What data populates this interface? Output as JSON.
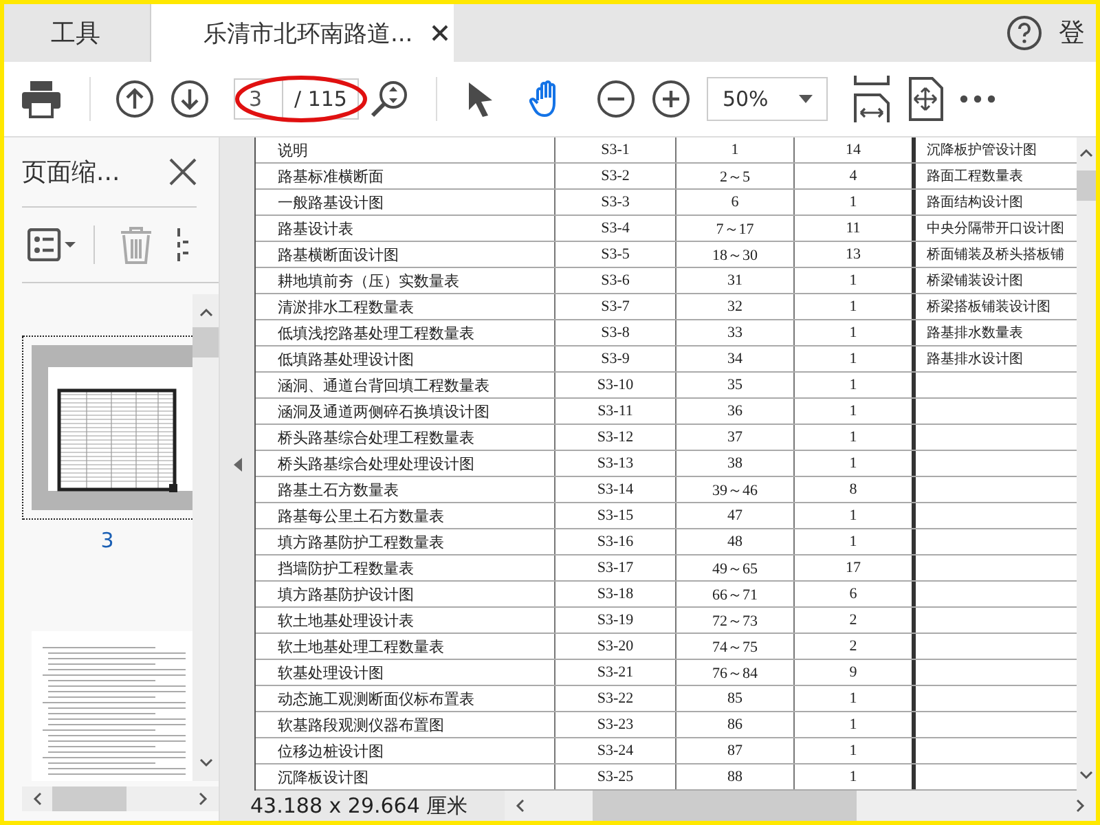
{
  "tabs": [
    {
      "label": "工具",
      "selected": false
    },
    {
      "label": "乐清市北环南路道...",
      "selected": true
    }
  ],
  "header": {
    "account_link": "登"
  },
  "toolbar": {
    "page_field": {
      "value": "3"
    },
    "page_total": "/ 115",
    "zoom": {
      "value": "50%"
    },
    "tools": [
      {
        "kind": "select",
        "selected": false
      },
      {
        "kind": "hand",
        "selected": true
      }
    ]
  },
  "side_panel": {
    "title": "页面缩...",
    "thumbnails": [
      {
        "kind": "table",
        "label": "3",
        "selected": true
      },
      {
        "kind": "text",
        "selected": false
      }
    ]
  },
  "document": {
    "rows": [
      {
        "name": "说明",
        "code": "S3-1",
        "pages": "1",
        "count": "14"
      },
      {
        "name": "路基标准横断面",
        "code": "S3-2",
        "pages": "2～5",
        "count": "4"
      },
      {
        "name": "一般路基设计图",
        "code": "S3-3",
        "pages": "6",
        "count": "1"
      },
      {
        "name": "路基设计表",
        "code": "S3-4",
        "pages": "7～17",
        "count": "11"
      },
      {
        "name": "路基横断面设计图",
        "code": "S3-5",
        "pages": "18～30",
        "count": "13"
      },
      {
        "name": "耕地填前夯（压）实数量表",
        "code": "S3-6",
        "pages": "31",
        "count": "1"
      },
      {
        "name": "清淤排水工程数量表",
        "code": "S3-7",
        "pages": "32",
        "count": "1"
      },
      {
        "name": "低填浅挖路基处理工程数量表",
        "code": "S3-8",
        "pages": "33",
        "count": "1"
      },
      {
        "name": "低填路基处理设计图",
        "code": "S3-9",
        "pages": "34",
        "count": "1"
      },
      {
        "name": "涵洞、通道台背回填工程数量表",
        "code": "S3-10",
        "pages": "35",
        "count": "1"
      },
      {
        "name": "涵洞及通道两侧碎石换填设计图",
        "code": "S3-11",
        "pages": "36",
        "count": "1"
      },
      {
        "name": "桥头路基综合处理工程数量表",
        "code": "S3-12",
        "pages": "37",
        "count": "1"
      },
      {
        "name": "桥头路基综合处理处理设计图",
        "code": "S3-13",
        "pages": "38",
        "count": "1"
      },
      {
        "name": "路基土石方数量表",
        "code": "S3-14",
        "pages": "39～46",
        "count": "8"
      },
      {
        "name": "路基每公里土石方数量表",
        "code": "S3-15",
        "pages": "47",
        "count": "1"
      },
      {
        "name": "填方路基防护工程数量表",
        "code": "S3-16",
        "pages": "48",
        "count": "1"
      },
      {
        "name": "挡墙防护工程数量表",
        "code": "S3-17",
        "pages": "49～65",
        "count": "17"
      },
      {
        "name": "填方路基防护设计图",
        "code": "S3-18",
        "pages": "66～71",
        "count": "6"
      },
      {
        "name": "软土地基处理设计表",
        "code": "S3-19",
        "pages": "72～73",
        "count": "2"
      },
      {
        "name": "软土地基处理工程数量表",
        "code": "S3-20",
        "pages": "74～75",
        "count": "2"
      },
      {
        "name": "软基处理设计图",
        "code": "S3-21",
        "pages": "76～84",
        "count": "9"
      },
      {
        "name": "动态施工观测断面仪标布置表",
        "code": "S3-22",
        "pages": "85",
        "count": "1"
      },
      {
        "name": "软基路段观测仪器布置图",
        "code": "S3-23",
        "pages": "86",
        "count": "1"
      },
      {
        "name": "位移边桩设计图",
        "code": "S3-24",
        "pages": "87",
        "count": "1"
      },
      {
        "name": "沉降板设计图",
        "code": "S3-25",
        "pages": "88",
        "count": "1"
      }
    ],
    "right_column": [
      "沉降板护管设计图",
      "路面工程数量表",
      "路面结构设计图",
      "中央分隔带开口设计图",
      "桥面铺装及桥头搭板铺",
      "桥梁铺装设计图",
      "桥梁搭板铺装设计图",
      "路基排水数量表",
      "路基排水设计图"
    ]
  },
  "status_bar": {
    "page_size": "43.188 x 29.664 厘米"
  }
}
